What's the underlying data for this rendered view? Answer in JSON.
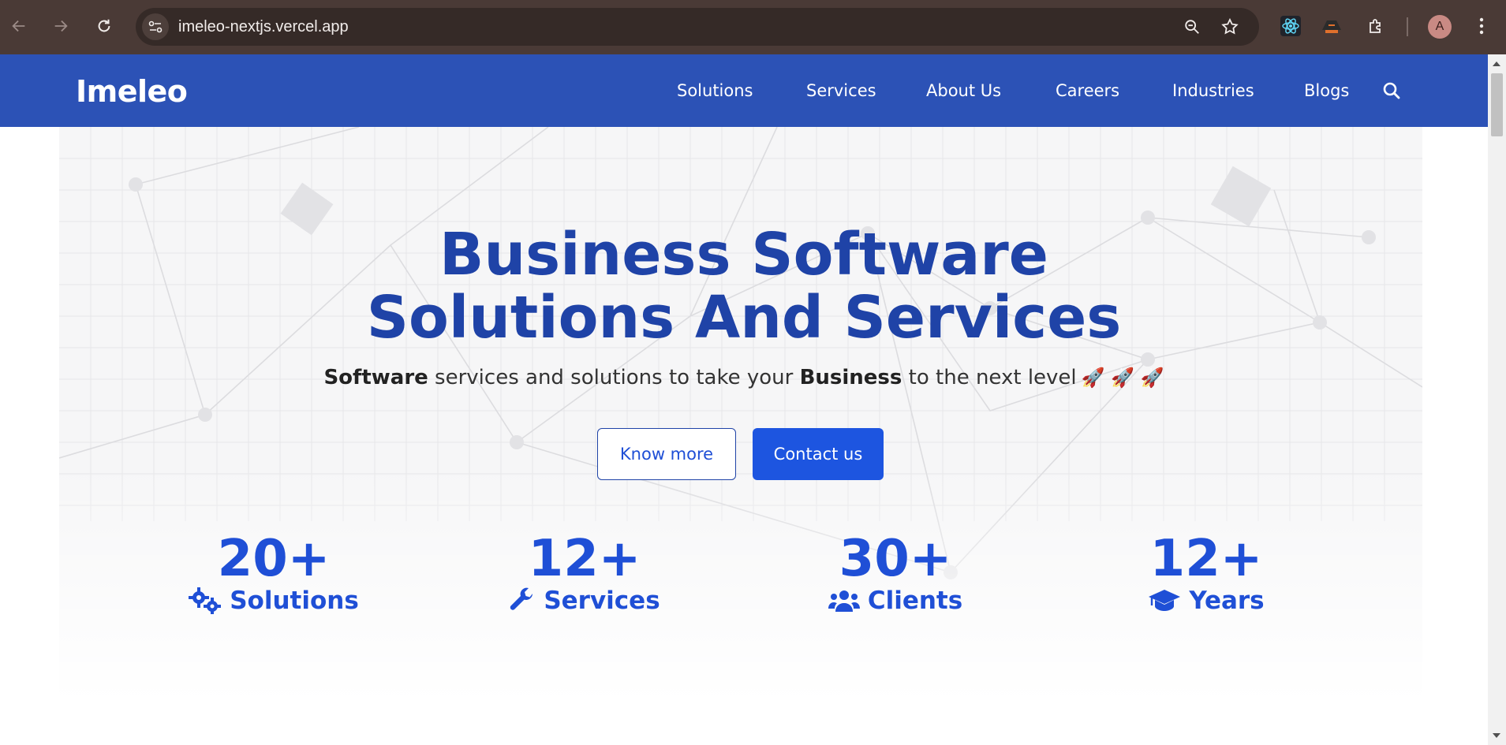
{
  "browser": {
    "url": "imeleo-nextjs.vercel.app",
    "profile_initial": "A",
    "icons": [
      "back-icon",
      "forward-icon",
      "reload-icon",
      "site-info-icon",
      "zoom-icon",
      "bookmark-star-icon",
      "react-devtools-icon",
      "extension-icon",
      "puzzle-icon",
      "menu-kebab-icon"
    ]
  },
  "navbar": {
    "brand": "Imeleo",
    "links": [
      "Solutions",
      "Services",
      "About Us",
      "Careers",
      "Industries",
      "Blogs"
    ],
    "search_icon": "search-icon",
    "color": "#2c52b6"
  },
  "hero": {
    "title_line1": "Business Software",
    "title_line2": "Solutions And Services",
    "subtitle_part1": "Software",
    "subtitle_part2": " services and solutions to take your ",
    "subtitle_part3": "Business",
    "subtitle_part4": " to the next level",
    "subtitle_emoji": "🚀 🚀 🚀",
    "know_more": "Know more",
    "contact_us": "Contact us",
    "title_color": "#1f43a7",
    "accent": "#1d55e0"
  },
  "stats": [
    {
      "number": "20+",
      "label": "Solutions",
      "icon": "gears-icon"
    },
    {
      "number": "12+",
      "label": "Services",
      "icon": "wrench-icon"
    },
    {
      "number": "30+",
      "label": "Clients",
      "icon": "users-icon"
    },
    {
      "number": "12+",
      "label": "Years",
      "icon": "graduation-cap-icon"
    }
  ]
}
